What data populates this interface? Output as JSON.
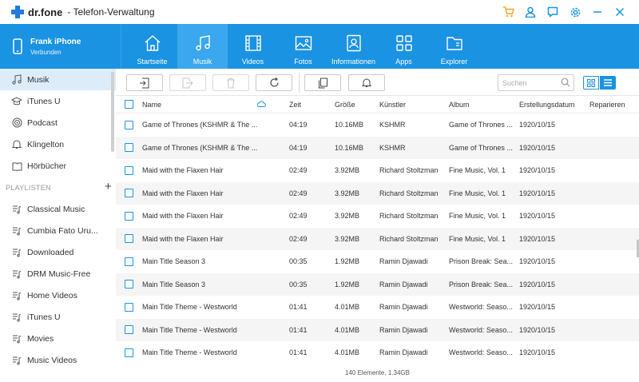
{
  "titlebar": {
    "logo_text": "dr.fone",
    "app_title": "- Telefon-Verwaltung",
    "accent": "#f5a623",
    "brand": "#1a93e2"
  },
  "device": {
    "name": "Frank iPhone",
    "status": "Verbunden"
  },
  "navtabs": [
    {
      "label": "Startseite",
      "icon": "home-icon"
    },
    {
      "label": "Musik",
      "icon": "music-icon",
      "active": true
    },
    {
      "label": "Videos",
      "icon": "film-icon"
    },
    {
      "label": "Fotos",
      "icon": "image-icon"
    },
    {
      "label": "Informationen",
      "icon": "contact-icon"
    },
    {
      "label": "Apps",
      "icon": "apps-icon"
    },
    {
      "label": "Explorer",
      "icon": "folder-icon"
    }
  ],
  "sidebar": {
    "items": [
      {
        "label": "Musik",
        "icon": "music-note-icon"
      },
      {
        "label": "iTunes U",
        "icon": "graduation-cap-icon"
      },
      {
        "label": "Podcast",
        "icon": "podcast-icon"
      },
      {
        "label": "Klingelton",
        "icon": "bell-icon"
      },
      {
        "label": "Hörbücher",
        "icon": "book-icon"
      }
    ],
    "playlists_header": "PLAYLISTEN",
    "playlists": [
      {
        "label": "Classical Music"
      },
      {
        "label": "Cumbia Fato Uru..."
      },
      {
        "label": "Downloaded"
      },
      {
        "label": "DRM Music-Free"
      },
      {
        "label": "Home Videos"
      },
      {
        "label": "iTunes U"
      },
      {
        "label": "Movies"
      },
      {
        "label": "Music Videos"
      }
    ]
  },
  "toolbar": {
    "search_placeholder": "Suchen"
  },
  "table": {
    "headers": {
      "name": "Name",
      "zeit": "Zeit",
      "groesse": "Größe",
      "kuenstler": "Künstler",
      "album": "Album",
      "datum": "Erstellungsdatum",
      "reparieren": "Reparieren"
    },
    "rows": [
      {
        "name": "Game of Thrones (KSHMR & The ...",
        "zeit": "04:19",
        "groesse": "10.16MB",
        "kuenstler": "KSHMR",
        "album": "Game of Thrones ...",
        "datum": "1920/10/15"
      },
      {
        "name": "Game of Thrones (KSHMR & The ...",
        "zeit": "04:19",
        "groesse": "10.16MB",
        "kuenstler": "KSHMR",
        "album": "Game of Thrones ...",
        "datum": "1920/10/15"
      },
      {
        "name": "Maid with the Flaxen Hair",
        "zeit": "02:49",
        "groesse": "3.92MB",
        "kuenstler": "Richard Stoltzman",
        "album": "Fine Music, Vol. 1",
        "datum": "1920/10/15"
      },
      {
        "name": "Maid with the Flaxen Hair",
        "zeit": "02:49",
        "groesse": "3.92MB",
        "kuenstler": "Richard Stoltzman",
        "album": "Fine Music, Vol. 1",
        "datum": "1920/10/15"
      },
      {
        "name": "Maid with the Flaxen Hair",
        "zeit": "02:49",
        "groesse": "3.92MB",
        "kuenstler": "Richard Stoltzman",
        "album": "Fine Music, Vol. 1",
        "datum": "1920/10/15"
      },
      {
        "name": "Maid with the Flaxen Hair",
        "zeit": "02:49",
        "groesse": "3.92MB",
        "kuenstler": "Richard Stoltzman",
        "album": "Fine Music, Vol. 1",
        "datum": "1920/10/15"
      },
      {
        "name": "Main Title Season 3",
        "zeit": "00:35",
        "groesse": "1.92MB",
        "kuenstler": "Ramin Djawadi",
        "album": "Prison Break: Sea...",
        "datum": "1920/10/15"
      },
      {
        "name": "Main Title Season 3",
        "zeit": "00:35",
        "groesse": "1.92MB",
        "kuenstler": "Ramin Djawadi",
        "album": "Prison Break: Sea...",
        "datum": "1920/10/15"
      },
      {
        "name": "Main Title Theme - Westworld",
        "zeit": "01:41",
        "groesse": "4.01MB",
        "kuenstler": "Ramin Djawadi",
        "album": "Westworld: Seaso...",
        "datum": "1920/10/15"
      },
      {
        "name": "Main Title Theme - Westworld",
        "zeit": "01:41",
        "groesse": "4.01MB",
        "kuenstler": "Ramin Djawadi",
        "album": "Westworld: Seaso...",
        "datum": "1920/10/15"
      },
      {
        "name": "Main Title Theme - Westworld",
        "zeit": "01:41",
        "groesse": "4.01MB",
        "kuenstler": "Ramin Djawadi",
        "album": "Westworld: Seaso...",
        "datum": "1920/10/15"
      }
    ]
  },
  "status": {
    "summary": "140 Elemente, 1.34GB"
  }
}
